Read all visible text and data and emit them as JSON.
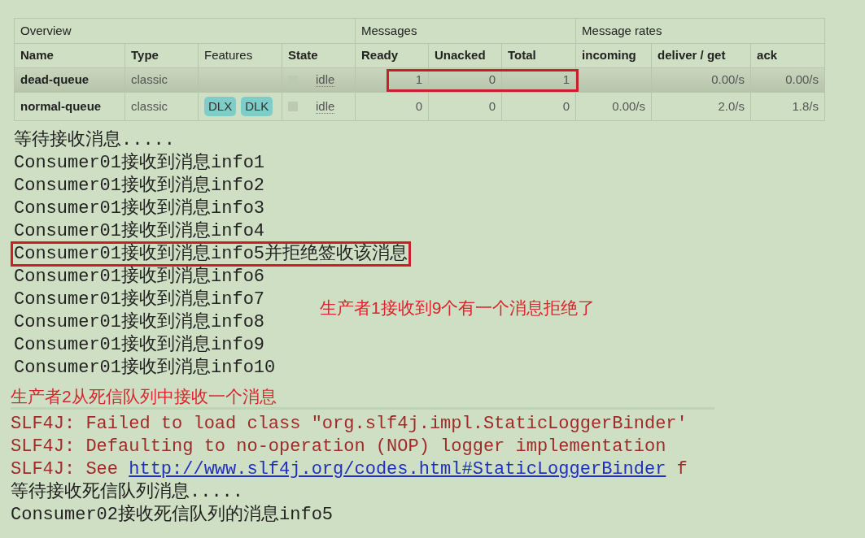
{
  "table": {
    "groups": [
      {
        "label": "Overview",
        "columns": [
          {
            "label": "Name",
            "bold": true
          },
          {
            "label": "Type",
            "bold": true
          },
          {
            "label": "Features",
            "bold": false
          },
          {
            "label": "State",
            "bold": true
          }
        ]
      },
      {
        "label": "Messages",
        "columns": [
          {
            "label": "Ready",
            "bold": true
          },
          {
            "label": "Unacked",
            "bold": true
          },
          {
            "label": "Total",
            "bold": true
          }
        ]
      },
      {
        "label": "Message rates",
        "columns": [
          {
            "label": "incoming",
            "bold": true
          },
          {
            "label": "deliver / get",
            "bold": true
          },
          {
            "label": "ack",
            "bold": true
          }
        ]
      }
    ],
    "rows": [
      {
        "name": "dead-queue",
        "type": "classic",
        "state": "idle",
        "ready": "1",
        "unacked": "0",
        "total": "1",
        "deliver_get": "0.00/s",
        "ack": "0.00/s",
        "highlighted": true,
        "counts_boxed": true
      },
      {
        "name": "normal-queue",
        "type": "classic",
        "features": [
          "DLX",
          "DLK"
        ],
        "state": "idle",
        "ready": "0",
        "unacked": "0",
        "total": "0",
        "incoming": "0.00/s",
        "deliver_get": "2.0/s",
        "ack": "1.8/s",
        "highlighted": false,
        "counts_boxed": false
      }
    ]
  },
  "console_1": {
    "lines": [
      {
        "text": "等待接收消息.....",
        "boxed": false
      },
      {
        "text": "Consumer01接收到消息info1",
        "boxed": false
      },
      {
        "text": "Consumer01接收到消息info2",
        "boxed": false
      },
      {
        "text": "Consumer01接收到消息info3",
        "boxed": false
      },
      {
        "text": "Consumer01接收到消息info4",
        "boxed": false
      },
      {
        "text": "Consumer01接收到消息info5并拒绝签收该消息",
        "boxed": true
      },
      {
        "text": "Consumer01接收到消息info6",
        "boxed": false
      },
      {
        "text": "Consumer01接收到消息info7",
        "boxed": false
      },
      {
        "text": "Consumer01接收到消息info8",
        "boxed": false
      },
      {
        "text": "Consumer01接收到消息info9",
        "boxed": false
      },
      {
        "text": "Consumer01接收到消息info10",
        "boxed": false
      }
    ]
  },
  "note_1": "生产者1接收到9个有一个消息拒绝了",
  "note_2": "生产者2从死信队列中接收一个消息",
  "console_2": {
    "lines": [
      {
        "kind": "log",
        "text": "SLF4J: Failed to load class \"org.slf4j.impl.StaticLoggerBinder'"
      },
      {
        "kind": "log",
        "text": "SLF4J: Defaulting to no-operation (NOP) logger implementation"
      },
      {
        "kind": "log",
        "text": "SLF4J: See ",
        "link": "http://www.slf4j.org/codes.html#StaticLoggerBinder",
        "after": " f"
      },
      {
        "kind": "output",
        "text": "等待接收死信队列消息....."
      },
      {
        "kind": "output",
        "text": "Consumer02接收死信队列的消息info5"
      }
    ]
  }
}
